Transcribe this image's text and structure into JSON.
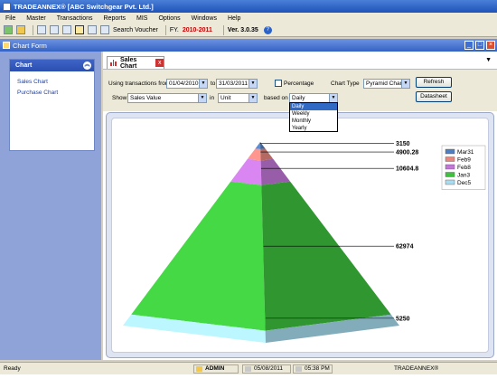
{
  "app": {
    "title": "TRADEANNEX® [ABC Switchgear Pvt. Ltd.]"
  },
  "menu": [
    "File",
    "Master",
    "Transactions",
    "Reports",
    "MIS",
    "Options",
    "Windows",
    "Help"
  ],
  "toolbar": {
    "search_label": "Search Voucher",
    "fy_label": "FY.",
    "fy_value": "2010-2011",
    "version": "Ver. 3.0.35"
  },
  "form": {
    "title": "Chart Form"
  },
  "sidebar": {
    "header": "Chart",
    "items": [
      {
        "label": "Sales Chart"
      },
      {
        "label": "Purchase Chart"
      }
    ]
  },
  "tab": {
    "label": "Sales Chart",
    "close": "x"
  },
  "controls": {
    "using_label": "Using transactions from",
    "from_date": "01/04/2010",
    "to_label": "to",
    "to_date": "31/03/2011",
    "percentage_label": "Percentage",
    "chart_type_label": "Chart Type",
    "chart_type_value": "Pyramid Chart",
    "refresh_label": "Refresh",
    "show_label": "Show",
    "show_value": "Sales Value",
    "in_label": "in",
    "in_value": "Unit",
    "based_on_label": "based on",
    "based_on_value": "Daily",
    "datasheet_label": "Datasheet"
  },
  "dropdown": {
    "options": [
      "Daily",
      "Weekly",
      "Monthly",
      "Yearly"
    ],
    "selected": "Daily"
  },
  "chart_data": {
    "type": "pyramid",
    "series": [
      {
        "name": "Mar31",
        "value": 3150,
        "label": "3150",
        "color": "#4f7fc0"
      },
      {
        "name": "Feb9",
        "value": 4900.28,
        "label": "4900.28",
        "color": "#e8877f"
      },
      {
        "name": "Feb8",
        "value": 10604.8,
        "label": "10604.8",
        "color": "#c277d8"
      },
      {
        "name": "Jan3",
        "value": 62974,
        "label": "62974",
        "color": "#3ec23e"
      },
      {
        "name": "Dec5",
        "value": 5250,
        "label": "5250",
        "color": "#a8dcf0"
      }
    ],
    "legend_position": "top-right"
  },
  "status": {
    "ready": "Ready",
    "user": "ADMIN",
    "date": "05/08/2011",
    "time": "05:38 PM",
    "brand": "TRADEANNEX®"
  }
}
